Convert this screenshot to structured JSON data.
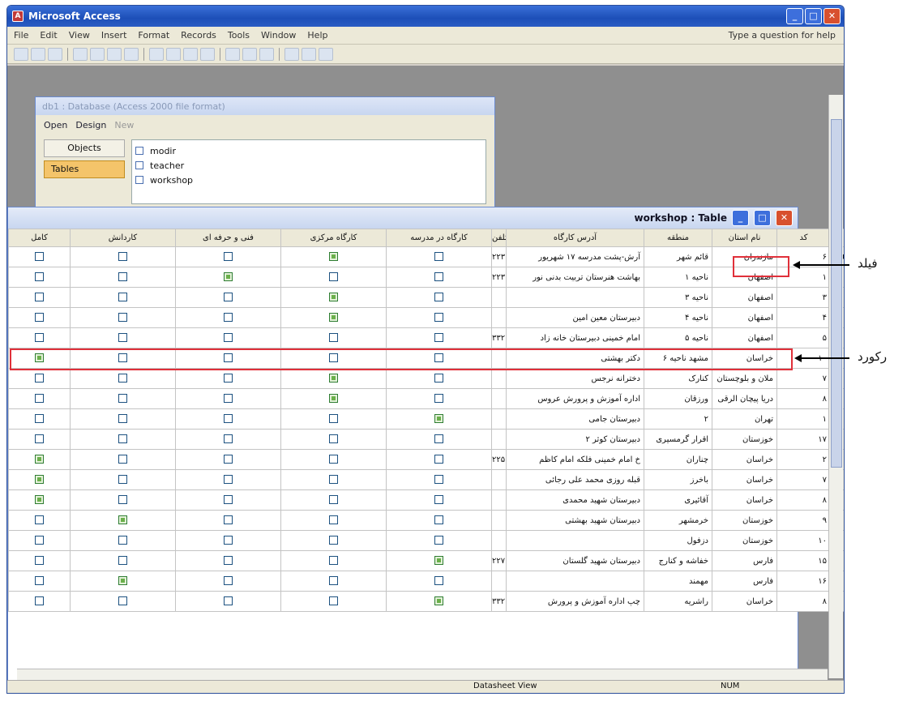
{
  "app": {
    "title": "Microsoft Access",
    "menu": [
      "File",
      "Edit",
      "View",
      "Insert",
      "Format",
      "Records",
      "Tools",
      "Window",
      "Help"
    ],
    "help_placeholder": "Type a question for help"
  },
  "db_window": {
    "title": "db1 : Database (Access 2000 file format)",
    "open_label": "Open",
    "design_label": "Design",
    "new_label": "New",
    "objects_header": "Objects",
    "objects_selected": "Tables",
    "items": [
      "modir",
      "teacher",
      "workshop"
    ]
  },
  "table_window": {
    "title": "workshop : Table",
    "columns": [
      "کد",
      "نام استان",
      "منطقه",
      "آدرس کارگاه",
      "تلفن",
      "کارگاه در مدرسه",
      "کارگاه مرکزی",
      "فنی و حرفه ای",
      "کاردانش",
      "کامل"
    ],
    "rows": [
      {
        "code": "۶",
        "province": "مازندران",
        "region": "قائم شهر",
        "address": "آرش-پشت مدرسه ۱۷ شهریور",
        "phone": "۲۲۳",
        "c1": false,
        "c2": true,
        "c3": false,
        "c4": false,
        "c5": false
      },
      {
        "code": "۱",
        "province": "اصفهان",
        "region": "ناحیه ۱",
        "address": "بهاشت هنرستان تربیت بدنی نور",
        "phone": "۲۲۳",
        "c1": false,
        "c2": false,
        "c3": true,
        "c4": false,
        "c5": false
      },
      {
        "code": "۳",
        "province": "اصفهان",
        "region": "ناحیه ۳",
        "address": "",
        "phone": "",
        "c1": false,
        "c2": true,
        "c3": false,
        "c4": false,
        "c5": false
      },
      {
        "code": "۴",
        "province": "اصفهان",
        "region": "ناحیه ۴",
        "address": "دبیرستان معین امین",
        "phone": "",
        "c1": false,
        "c2": true,
        "c3": false,
        "c4": false,
        "c5": false
      },
      {
        "code": "۵",
        "province": "اصفهان",
        "region": "ناحیه ۵",
        "address": "امام خمینی دبیرستان خانه زاد",
        "phone": "۳۳۲",
        "c1": false,
        "c2": false,
        "c3": false,
        "c4": false,
        "c5": false
      },
      {
        "code": "۱۰",
        "province": "خراسان",
        "region": "مشهد ناحیه ۶",
        "address": "دکتر بهشتی",
        "phone": "",
        "c1": false,
        "c2": false,
        "c3": false,
        "c4": false,
        "c5": true
      },
      {
        "code": "۷",
        "province": "ملان و بلوچستان",
        "region": "کنارک",
        "address": "دخترانه نرجس",
        "phone": "",
        "c1": false,
        "c2": true,
        "c3": false,
        "c4": false,
        "c5": false
      },
      {
        "code": "۸",
        "province": "دریا پیچان الرقی",
        "region": "ورزقان",
        "address": "اداره آموزش و پرورش عروس",
        "phone": "",
        "c1": false,
        "c2": true,
        "c3": false,
        "c4": false,
        "c5": false
      },
      {
        "code": "۱",
        "province": "تهران",
        "region": "۲",
        "address": "دبیرستان جامی",
        "phone": "",
        "c1": true,
        "c2": false,
        "c3": false,
        "c4": false,
        "c5": false
      },
      {
        "code": "۱۷",
        "province": "خوزستان",
        "region": "اقرار گرمسیری",
        "address": "دبیرستان کوثر ۲",
        "phone": "",
        "c1": false,
        "c2": false,
        "c3": false,
        "c4": false,
        "c5": false
      },
      {
        "code": "۲",
        "province": "خراسان",
        "region": "چناران",
        "address": "خ امام خمینی فلکه امام کاظم",
        "phone": "۲۲۵",
        "c1": false,
        "c2": false,
        "c3": false,
        "c4": false,
        "c5": true
      },
      {
        "code": "۷",
        "province": "خراسان",
        "region": "باخرز",
        "address": "قبله روزی محمد علی رجائی",
        "phone": "",
        "c1": false,
        "c2": false,
        "c3": false,
        "c4": false,
        "c5": true
      },
      {
        "code": "۸",
        "province": "خراسان",
        "region": "آقائیری",
        "address": "دبیرستان شهید محمدی",
        "phone": "",
        "c1": false,
        "c2": false,
        "c3": false,
        "c4": false,
        "c5": true
      },
      {
        "code": "۹",
        "province": "خوزستان",
        "region": "خرمشهر",
        "address": "دبیرستان شهید بهشتی",
        "phone": "",
        "c1": false,
        "c2": false,
        "c3": false,
        "c4": true,
        "c5": false
      },
      {
        "code": "۱۰",
        "province": "خوزستان",
        "region": "دزفول",
        "address": "",
        "phone": "",
        "c1": false,
        "c2": false,
        "c3": false,
        "c4": false,
        "c5": false
      },
      {
        "code": "۱۵",
        "province": "فارس",
        "region": "خفاشه و کنارج",
        "address": "دبیرستان شهید گلستان",
        "phone": "۲۲۷",
        "c1": true,
        "c2": false,
        "c3": false,
        "c4": false,
        "c5": false
      },
      {
        "code": "۱۶",
        "province": "فارس",
        "region": "مهمند",
        "address": "",
        "phone": "",
        "c1": false,
        "c2": false,
        "c3": false,
        "c4": true,
        "c5": false
      },
      {
        "code": "۸",
        "province": "خراسان",
        "region": "راشریه",
        "address": "چپ اداره آموزش و پرورش",
        "phone": "۳۳۲",
        "c1": true,
        "c2": false,
        "c3": false,
        "c4": false,
        "c5": false
      }
    ]
  },
  "callouts": {
    "field": "فیلد",
    "record": "رکورد"
  },
  "status": {
    "view": "Datasheet View",
    "num": "NUM"
  }
}
